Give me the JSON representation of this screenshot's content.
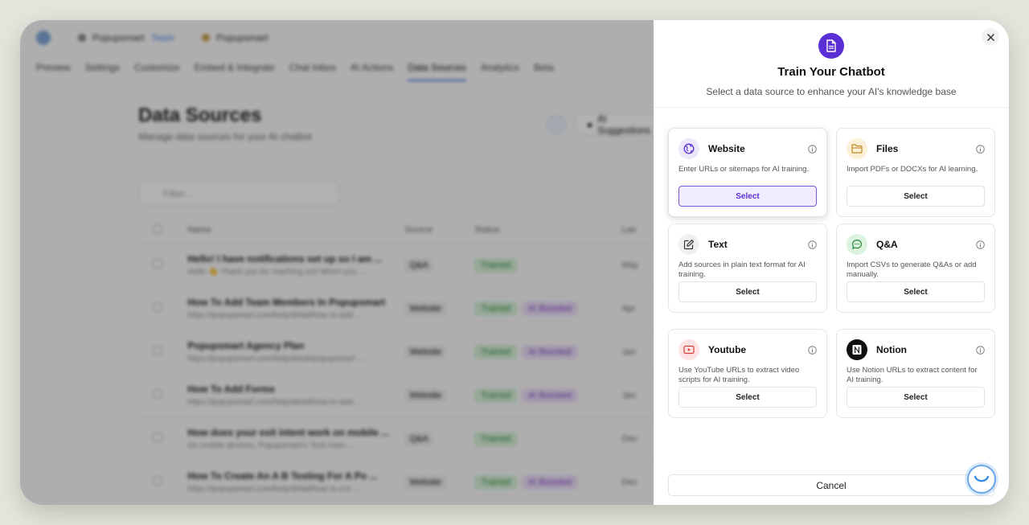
{
  "background": {
    "workspace_name": "Popupsmart",
    "plan_label": "Team",
    "project_name": "Popupsmart",
    "tabs": [
      "Preview",
      "Settings",
      "Customize",
      "Embed & Integrate",
      "Chat Inbox",
      "AI Actions",
      "Data Sources",
      "Analytics",
      "Beta"
    ],
    "page_title": "Data Sources",
    "page_subtitle": "Manage data sources for your AI chatbot",
    "ai_button_label": "AI Suggestions",
    "filter_placeholder": "Filter...",
    "table_headers": [
      "Name",
      "Source",
      "Status",
      "Las"
    ],
    "rows": [
      {
        "title": "Hello! I have notifications set up so I am ...",
        "preview": "Hello 👋 Thank you for reaching out! When you ...",
        "source": "Q&A",
        "status": "Trained",
        "badge": "",
        "last": "May"
      },
      {
        "title": "How To Add Team Members In Popupsmart",
        "preview": "https://popupsmart.com/help/detail/how-to-add ...",
        "source": "Website",
        "status": "Trained",
        "badge": "AI Boosted",
        "last": "Apr"
      },
      {
        "title": "Popupsmart Agency Plan",
        "preview": "https://popupsmart.com/help/detail/popupsmart ...",
        "source": "Website",
        "status": "Trained",
        "badge": "AI Boosted",
        "last": "Jan"
      },
      {
        "title": "How To Add Forms",
        "preview": "https://popupsmart.com/help/detail/how-to-add ...",
        "source": "Website",
        "status": "Trained",
        "badge": "AI Boosted",
        "last": "Jan"
      },
      {
        "title": "How does your exit intent work on mobile ...",
        "preview": "On mobile devices, Popupsmart's \"Exit Inten ...",
        "source": "Q&A",
        "status": "Trained",
        "badge": "",
        "last": "Dec"
      },
      {
        "title": "How To Create An A B Testing For A Po ...",
        "preview": "https://popupsmart.com/help/detail/how-to-cre ...",
        "source": "Website",
        "status": "Trained",
        "badge": "AI Boosted",
        "last": "Dec"
      }
    ]
  },
  "modal": {
    "title": "Train Your Chatbot",
    "subtitle": "Select a data source to enhance your AI's knowledge base",
    "cancel_label": "Cancel",
    "accent_color": "#5b2fd6",
    "sources": [
      {
        "name": "Website",
        "description": "Enter URLs or sitemaps for AI training.",
        "button": "Select",
        "icon": "globe-icon",
        "selected": true
      },
      {
        "name": "Files",
        "description": "Import PDFs or DOCXs for AI learning.",
        "button": "Select",
        "icon": "folder-icon",
        "selected": false
      },
      {
        "name": "Text",
        "description": "Add sources in plain text format for AI training.",
        "button": "Select",
        "icon": "edit-icon",
        "selected": false
      },
      {
        "name": "Q&A",
        "description": "Import CSVs to generate Q&As or add manually.",
        "button": "Select",
        "icon": "chat-icon",
        "selected": false
      },
      {
        "name": "Youtube",
        "description": "Use YouTube URLs to extract video scripts for AI training.",
        "button": "Select",
        "icon": "youtube-icon",
        "selected": false
      },
      {
        "name": "Notion",
        "description": "Use Notion URLs to extract content for AI training.",
        "button": "Select",
        "icon": "notion-icon",
        "selected": false
      }
    ]
  }
}
